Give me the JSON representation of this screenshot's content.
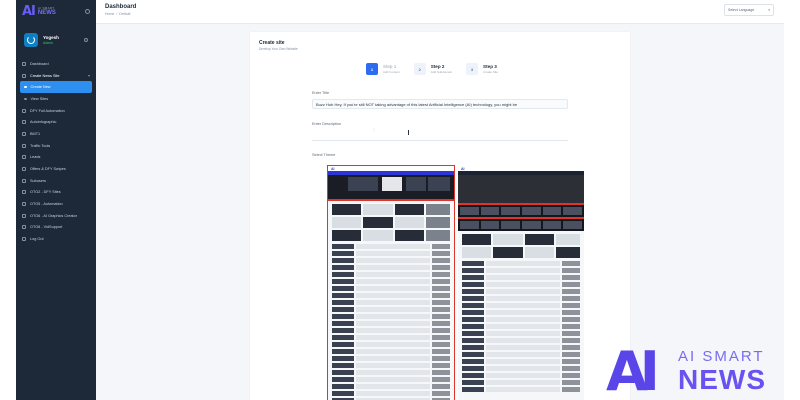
{
  "sidebar": {
    "brand": {
      "logo": "AI",
      "small": "AI SMART",
      "big": "NEWS"
    },
    "profile": {
      "name": "Yogesh",
      "role": "Admin"
    },
    "items": [
      {
        "label": "Dashboard"
      },
      {
        "label": "Create News Site"
      },
      {
        "label": "DFY Full Automation"
      },
      {
        "label": "Autoinfographic"
      },
      {
        "label": "BMT1"
      },
      {
        "label": "Traffic Tools"
      },
      {
        "label": "Leads"
      },
      {
        "label": "Offers & DFY Swipes"
      },
      {
        "label": "Subusers"
      },
      {
        "label": "OTO2 - DFY Sites"
      },
      {
        "label": "OTO5 - Automation"
      },
      {
        "label": "OTO6 - AI Graphics Creator"
      },
      {
        "label": "OTO8 - VidSupport"
      },
      {
        "label": "Log Out"
      }
    ],
    "sub_items": [
      {
        "label": "Create New"
      },
      {
        "label": "View Sites"
      }
    ]
  },
  "topbar": {
    "title": "Dashboard",
    "breadcrumb": [
      "Home",
      "/",
      "Default"
    ],
    "language": "Select Language"
  },
  "card": {
    "title": "Create site",
    "subtitle": "Develop Your Own Website",
    "steps": [
      {
        "num": "1",
        "title": "Step 1",
        "desc": "Add Content"
      },
      {
        "num": "2",
        "title": "Step 2",
        "desc": "Add Subdomain"
      },
      {
        "num": "3",
        "title": "Step 3",
        "desc": "Create Site"
      }
    ],
    "title_label": "Enter Title",
    "title_value": "Buzz Hub Hey,  If you're still NOT taking advantage of this latest Artificial Intelligence (AI) technology, you might be",
    "desc_label": "Enter Description",
    "theme_label": "Select Theme"
  },
  "watermark": {
    "small": "AI SMART",
    "big": "NEWS"
  },
  "colors": {
    "sidebar": "#1d2939",
    "accent": "#2d6cf0",
    "active_nav": "#2d8ff0",
    "selected_theme": "#e0342b",
    "brand": "#6852f0"
  }
}
